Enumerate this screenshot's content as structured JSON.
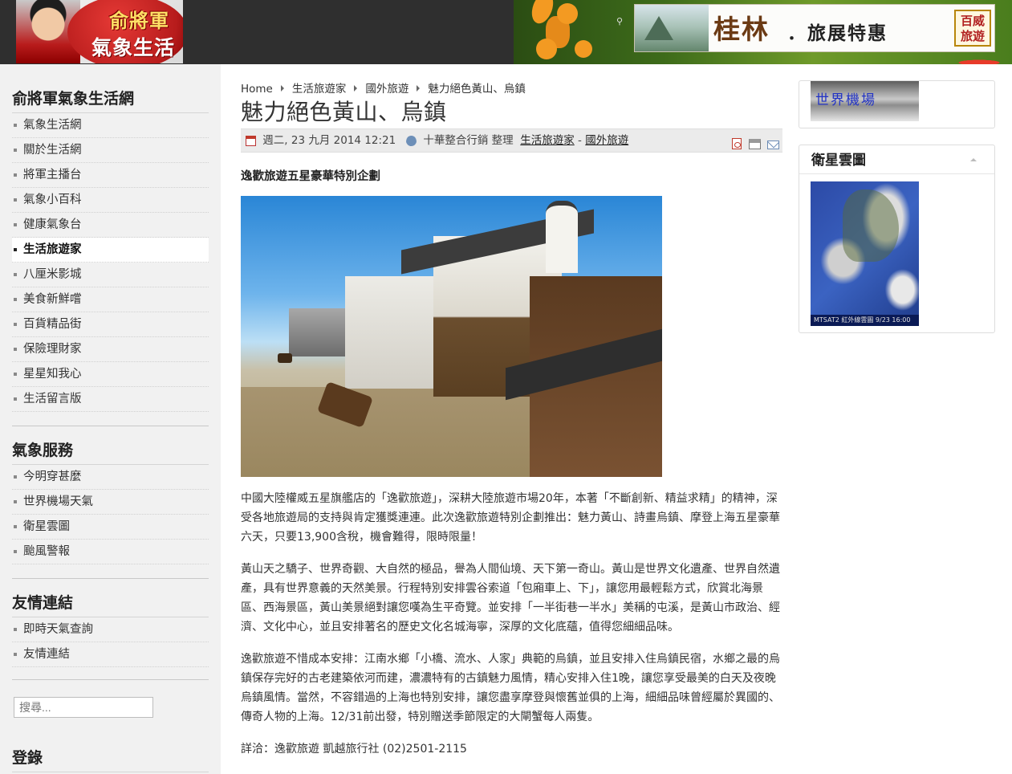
{
  "header": {
    "logo_line1": "俞將軍",
    "logo_line2": "氣象生活網",
    "search_icon": "search-icon",
    "banner": {
      "big_text": "桂林",
      "small_text": "．旅展特惠",
      "badge_line1": "百威",
      "badge_line2": "旅遊"
    }
  },
  "sidebar": {
    "main_menu": {
      "title": "俞將軍氣象生活網",
      "items": [
        {
          "label": "氣象生活網"
        },
        {
          "label": "關於生活網"
        },
        {
          "label": "將軍主播台"
        },
        {
          "label": "氣象小百科"
        },
        {
          "label": "健康氣象台"
        },
        {
          "label": "生活旅遊家",
          "active": true
        },
        {
          "label": "八厘米影城"
        },
        {
          "label": "美食新鮮嚐"
        },
        {
          "label": "百貨精品街"
        },
        {
          "label": "保險理財家"
        },
        {
          "label": "星星知我心"
        },
        {
          "label": "生活留言版"
        }
      ]
    },
    "weather_service": {
      "title": "氣象服務",
      "items": [
        {
          "label": "今明穿甚麼"
        },
        {
          "label": "世界機場天氣"
        },
        {
          "label": "衛星雲圖"
        },
        {
          "label": "颱風警報"
        }
      ]
    },
    "links": {
      "title": "友情連結",
      "items": [
        {
          "label": "即時天氣查詢"
        },
        {
          "label": "友情連結"
        }
      ]
    },
    "search": {
      "placeholder": "搜尋..."
    },
    "login": {
      "title": "登錄"
    }
  },
  "main": {
    "breadcrumb": [
      "Home",
      "生活旅遊家",
      "國外旅遊",
      "魅力絕色黃山、烏鎮"
    ],
    "title": "魅力絕色黃山、烏鎮",
    "meta": {
      "date": "週二, 23 九月 2014 12:21",
      "author": "十華整合行銷 整理",
      "category_parent": "生活旅遊家",
      "category_sep": " - ",
      "category": "國外旅遊"
    },
    "subtitle": "逸歡旅遊五星豪華特別企劃",
    "paragraphs": [
      "中國大陸權威五星旗艦店的「逸歡旅遊」，深耕大陸旅遊市場20年，本著「不斷創新、精益求精」的精神，深受各地旅遊局的支持與肯定獲獎連連。此次逸歡旅遊特別企劃推出：魅力黃山、詩畫烏鎮、摩登上海五星豪華六天，只要13,900含稅，機會難得，限時限量！",
      "黃山天之驕子、世界奇觀、大自然的極品，譽為人間仙境、天下第一奇山。黃山是世界文化遺產、世界自然遺產，具有世界意義的天然美景。行程特別安排雲谷索道「包廂車上、下」，讓您用最輕鬆方式，欣賞北海景區、西海景區，黃山美景絕對讓您嘆為生平奇覽。並安排「一半街巷一半水」美稱的屯溪，是黃山市政治、經濟、文化中心，並且安排著名的歷史文化名城海寧，深厚的文化底蘊，值得您細細品味。",
      "逸歡旅遊不惜成本安排：江南水鄉「小橋、流水、人家」典範的烏鎮，並且安排入住烏鎮民宿，水鄉之最的烏鎮保存完好的古老建築依河而建，濃濃特有的古鎮魅力風情，精心安排入住1晚，讓您享受最美的白天及夜晚烏鎮風情。當然，不容錯過的上海也特別安排，讓您盡享摩登與懷舊並俱的上海，細細品味曾經屬於異國的、傳奇人物的上海。12/31前出發，特別贈送季節限定的大閘蟹每人兩隻。",
      "詳洽：逸歡旅遊 凱越旅行社 (02)2501-2115"
    ]
  },
  "right": {
    "airport_banner": "世界機場",
    "satellite": {
      "title": "衛星雲圖",
      "caption": "MTSAT2 紅外線雲圖   9/23 16:00"
    }
  }
}
